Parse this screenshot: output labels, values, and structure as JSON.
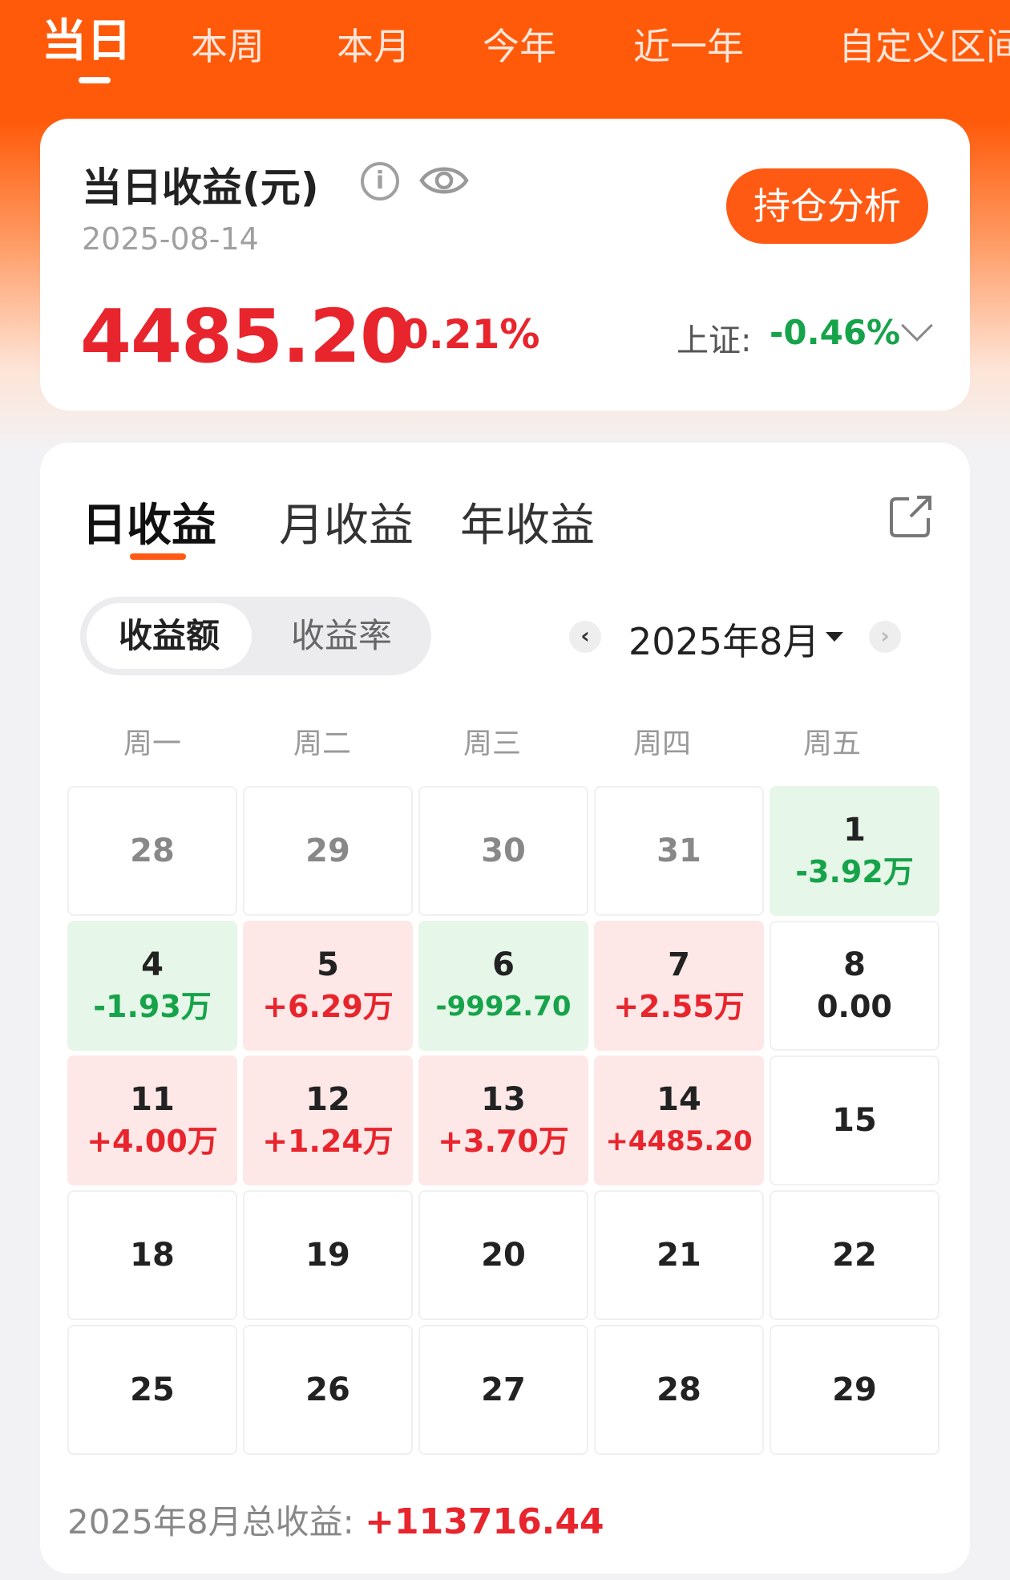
{
  "period_tabs": [
    "当日",
    "本周",
    "本月",
    "今年",
    "近一年",
    "自定义区间"
  ],
  "active_period": "当日",
  "summary": {
    "title": "当日收益(元)",
    "info_glyph": "i",
    "date": "2025-08-14",
    "analysis_button": "持仓分析",
    "amount": "4485.20",
    "rate": "0.21%",
    "index_label": "上证:",
    "index_value": "-0.46%"
  },
  "calendar": {
    "view_tabs": [
      "日收益",
      "月收益",
      "年收益"
    ],
    "active_view": "日收益",
    "segments": [
      "收益额",
      "收益率"
    ],
    "active_segment": "收益额",
    "prev_glyph": "‹",
    "next_glyph": "›",
    "month": "2025年8月",
    "weekdays": [
      "周一",
      "周二",
      "周三",
      "周四",
      "周五"
    ],
    "weeks": [
      [
        {
          "day": "28",
          "value": "",
          "status": "muted"
        },
        {
          "day": "29",
          "value": "",
          "status": "muted"
        },
        {
          "day": "30",
          "value": "",
          "status": "muted"
        },
        {
          "day": "31",
          "value": "",
          "status": "muted"
        },
        {
          "day": "1",
          "value": "-3.92万",
          "status": "loss"
        }
      ],
      [
        {
          "day": "4",
          "value": "-1.93万",
          "status": "loss"
        },
        {
          "day": "5",
          "value": "+6.29万",
          "status": "gain"
        },
        {
          "day": "6",
          "value": "-9992.70",
          "status": "loss"
        },
        {
          "day": "7",
          "value": "+2.55万",
          "status": "gain"
        },
        {
          "day": "8",
          "value": "0.00",
          "status": "zero"
        }
      ],
      [
        {
          "day": "11",
          "value": "+4.00万",
          "status": "gain"
        },
        {
          "day": "12",
          "value": "+1.24万",
          "status": "gain"
        },
        {
          "day": "13",
          "value": "+3.70万",
          "status": "gain"
        },
        {
          "day": "14",
          "value": "+4485.20",
          "status": "gain"
        },
        {
          "day": "15",
          "value": "",
          "status": "none"
        }
      ],
      [
        {
          "day": "18",
          "value": "",
          "status": "none"
        },
        {
          "day": "19",
          "value": "",
          "status": "none"
        },
        {
          "day": "20",
          "value": "",
          "status": "none"
        },
        {
          "day": "21",
          "value": "",
          "status": "none"
        },
        {
          "day": "22",
          "value": "",
          "status": "none"
        }
      ],
      [
        {
          "day": "25",
          "value": "",
          "status": "none"
        },
        {
          "day": "26",
          "value": "",
          "status": "none"
        },
        {
          "day": "27",
          "value": "",
          "status": "none"
        },
        {
          "day": "28",
          "value": "",
          "status": "none"
        },
        {
          "day": "29",
          "value": "",
          "status": "none"
        }
      ]
    ],
    "total_label": "2025年8月总收益:",
    "total_value": "+113716.44"
  },
  "colors": {
    "brand_orange": "#ff5a14",
    "gain_red": "#e8242c",
    "loss_green": "#16a34a",
    "gain_bg": "#fde7e7",
    "loss_bg": "#e6f6e8"
  },
  "icons": [
    "info-icon",
    "eye-icon",
    "chevron-down-icon",
    "share-icon",
    "chevron-left-icon",
    "chevron-right-icon",
    "caret-down-icon"
  ]
}
